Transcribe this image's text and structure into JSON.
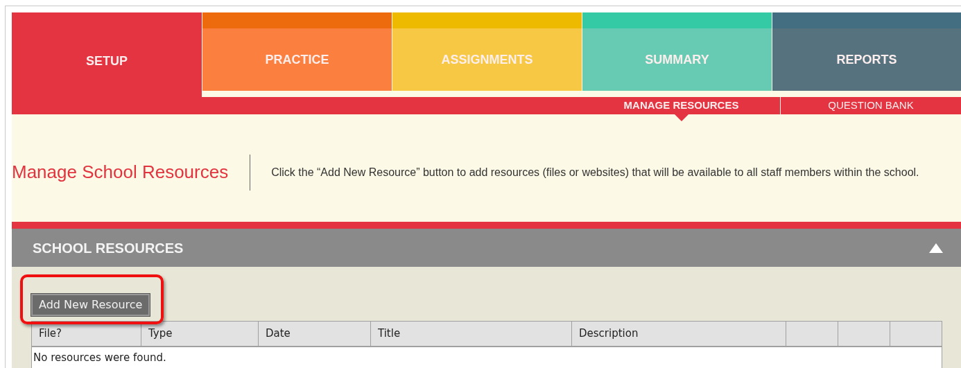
{
  "tabs": [
    {
      "label": "SETUP",
      "selected": true,
      "color": "#e43441"
    },
    {
      "label": "PRACTICE",
      "selected": false,
      "color": "#fb8040"
    },
    {
      "label": "ASSIGNMENTS",
      "selected": false,
      "color": "#f6c843"
    },
    {
      "label": "SUMMARY",
      "selected": false,
      "color": "#66cbb2"
    },
    {
      "label": "REPORTS",
      "selected": false,
      "color": "#56727f"
    }
  ],
  "subnav": [
    {
      "label": "MANAGE RESOURCES",
      "selected": true
    },
    {
      "label": "QUESTION BANK",
      "selected": false
    }
  ],
  "page": {
    "title": "Manage School Resources",
    "description": "Click the “Add New Resource” button to add resources (files or websites) that will be available to all staff members within the school."
  },
  "section": {
    "title": "SCHOOL RESOURCES",
    "expanded": true,
    "add_button": "Add New Resource",
    "table": {
      "columns": [
        "File?",
        "Type",
        "Date",
        "Title",
        "Description"
      ],
      "empty_message": "No resources were found."
    }
  }
}
